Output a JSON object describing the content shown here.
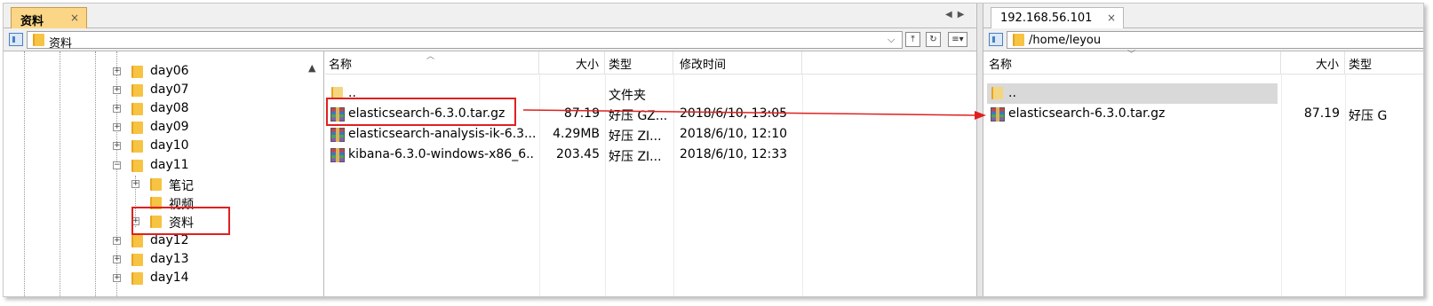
{
  "local": {
    "tab_label": "资料",
    "tab_close": "×",
    "path": "资料",
    "tree": [
      {
        "label": "day06",
        "state": "collapsed"
      },
      {
        "label": "day07",
        "state": "collapsed"
      },
      {
        "label": "day08",
        "state": "collapsed"
      },
      {
        "label": "day09",
        "state": "collapsed"
      },
      {
        "label": "day10",
        "state": "collapsed"
      },
      {
        "label": "day11",
        "state": "expanded"
      },
      {
        "label": "笔记",
        "state": "collapsed"
      },
      {
        "label": "视频",
        "state": "leaf"
      },
      {
        "label": "资料",
        "state": "collapsed"
      },
      {
        "label": "day12",
        "state": "collapsed"
      },
      {
        "label": "day13",
        "state": "collapsed"
      },
      {
        "label": "day14",
        "state": "collapsed"
      }
    ],
    "columns": {
      "name": "名称",
      "size": "大小",
      "type": "类型",
      "modified": "修改时间"
    },
    "files": [
      {
        "name": "..",
        "size": "",
        "type": "文件夹",
        "modified": "",
        "icon": "folder-icon"
      },
      {
        "name": "elasticsearch-6.3.0.tar.gz",
        "size": "87.19",
        "type": "好压 GZ...",
        "modified": "2018/6/10, 13:05",
        "icon": "archive-icon"
      },
      {
        "name": "elasticsearch-analysis-ik-6.3....",
        "size": "4.29MB",
        "type": "好压 ZI...",
        "modified": "2018/6/10, 12:10",
        "icon": "archive-icon"
      },
      {
        "name": "kibana-6.3.0-windows-x86_6...",
        "size": "203.45",
        "type": "好压 ZI...",
        "modified": "2018/6/10, 12:33",
        "icon": "archive-icon"
      }
    ]
  },
  "remote": {
    "tab_label": "192.168.56.101",
    "tab_close": "×",
    "path": "/home/leyou",
    "columns": {
      "name": "名称",
      "size": "大小",
      "type": "类型"
    },
    "files": [
      {
        "name": "..",
        "size": "",
        "type": "",
        "icon": "folder-icon"
      },
      {
        "name": "elasticsearch-6.3.0.tar.gz",
        "size": "87.19",
        "type": "好压 G",
        "icon": "archive-icon"
      }
    ]
  },
  "colors": {
    "active_tab": "#fbd686",
    "highlight": "#e02020",
    "folder": "#f6c343"
  }
}
